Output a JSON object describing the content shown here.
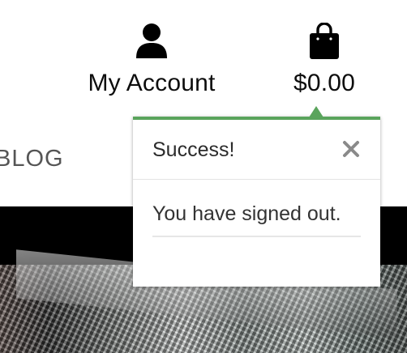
{
  "header": {
    "account": {
      "label": "My Account",
      "icon": "user-icon"
    },
    "cart": {
      "label": "$0.00",
      "icon": "shopping-bag-icon"
    }
  },
  "nav": {
    "blog_label": "BLOG"
  },
  "notification": {
    "title": "Success!",
    "message": "You have signed out.",
    "close_icon": "close-icon",
    "accent_color": "#5aa45c"
  }
}
